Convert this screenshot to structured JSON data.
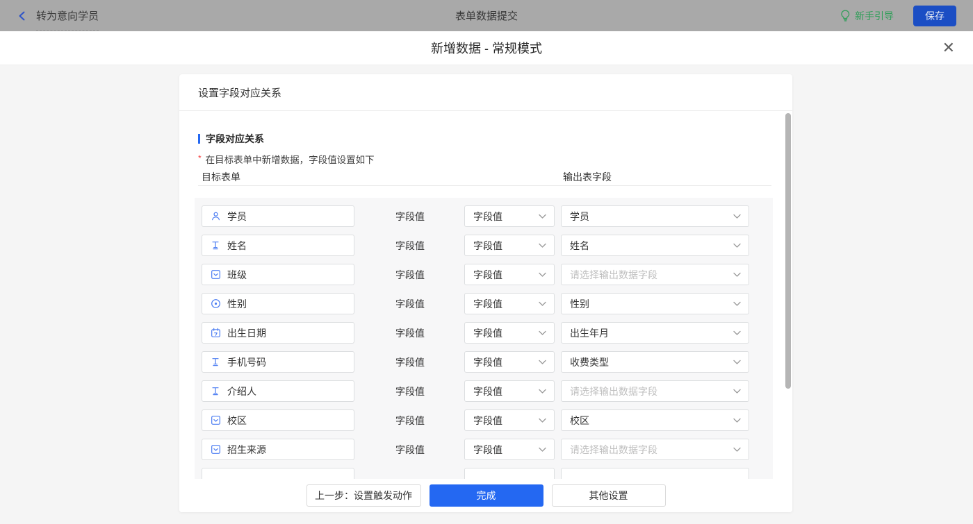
{
  "topbar": {
    "back_label": "转为意向学员",
    "title": "表单数据提交",
    "guide_label": "新手引导",
    "save_label": "保存"
  },
  "modal": {
    "title": "新增数据 - 常规模式",
    "close_glyph": "✕"
  },
  "card": {
    "header": "设置字段对应关系",
    "section_title": "字段对应关系",
    "required_mark": "*",
    "description": "在目标表单中新增数据，字段值设置如下",
    "col_left": "目标表单",
    "col_right": "输出表字段",
    "rows": [
      {
        "field": "学员",
        "icon": "user-icon",
        "mode": "字段值",
        "output": "学员",
        "is_placeholder": false
      },
      {
        "field": "姓名",
        "icon": "text-icon",
        "mode": "字段值",
        "output": "姓名",
        "is_placeholder": false
      },
      {
        "field": "班级",
        "icon": "select-icon",
        "mode": "字段值",
        "output": "请选择输出数据字段",
        "is_placeholder": true
      },
      {
        "field": "性别",
        "icon": "radio-icon",
        "mode": "字段值",
        "output": "性别",
        "is_placeholder": false
      },
      {
        "field": "出生日期",
        "icon": "calendar-icon",
        "mode": "字段值",
        "output": "出生年月",
        "is_placeholder": false
      },
      {
        "field": "手机号码",
        "icon": "text-icon",
        "mode": "字段值",
        "output": "收费类型",
        "is_placeholder": false
      },
      {
        "field": "介绍人",
        "icon": "text-icon",
        "mode": "字段值",
        "output": "请选择输出数据字段",
        "is_placeholder": true
      },
      {
        "field": "校区",
        "icon": "select-icon",
        "mode": "字段值",
        "output": "校区",
        "is_placeholder": false
      },
      {
        "field": "招生来源",
        "icon": "select-icon",
        "mode": "字段值",
        "output": "请选择输出数据字段",
        "is_placeholder": true
      }
    ],
    "partial_row_visible": true,
    "footer": {
      "prev_label": "上一步：设置触发动作",
      "done_label": "完成",
      "other_label": "其他设置"
    }
  },
  "colors": {
    "accent_blue": "#2468f2",
    "guide_green": "#2f9e58",
    "save_button_blue": "#1b4ec4",
    "field_icon_blue": "#4c7df2",
    "required_red": "#f53f3f",
    "topbar_gray": "#a9a9a9"
  }
}
